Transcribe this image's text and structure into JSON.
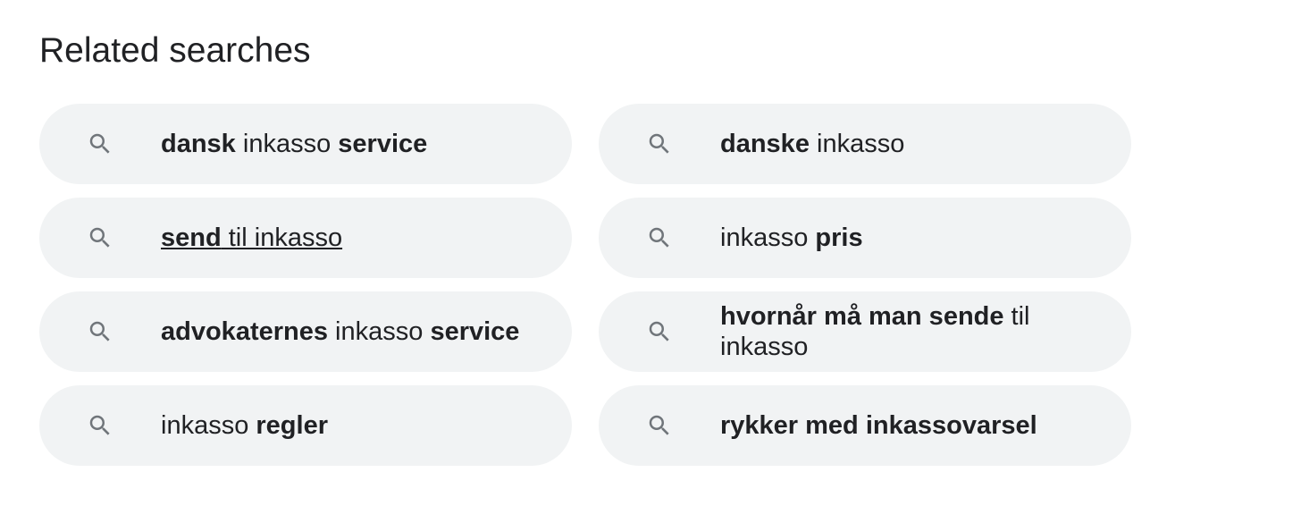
{
  "heading": "Related searches",
  "icon": "search-icon",
  "colors": {
    "chip_bg": "#f1f3f4",
    "text": "#202124",
    "icon": "#70757a"
  },
  "items": [
    {
      "segments": [
        {
          "text": "dansk",
          "bold": true
        },
        {
          "text": " inkasso ",
          "bold": false
        },
        {
          "text": "service",
          "bold": true
        }
      ]
    },
    {
      "segments": [
        {
          "text": "danske",
          "bold": true
        },
        {
          "text": " inkasso",
          "bold": false
        }
      ]
    },
    {
      "segments": [
        {
          "text": "send",
          "bold": true
        },
        {
          "text": " til inkasso",
          "bold": false
        }
      ],
      "hovered": true
    },
    {
      "segments": [
        {
          "text": "inkasso ",
          "bold": false
        },
        {
          "text": "pris",
          "bold": true
        }
      ]
    },
    {
      "segments": [
        {
          "text": "advokaternes",
          "bold": true
        },
        {
          "text": " inkasso ",
          "bold": false
        },
        {
          "text": "service",
          "bold": true
        }
      ]
    },
    {
      "segments": [
        {
          "text": "hvornår må man sende",
          "bold": true
        },
        {
          "text": " til inkasso",
          "bold": false
        }
      ]
    },
    {
      "segments": [
        {
          "text": "inkasso ",
          "bold": false
        },
        {
          "text": "regler",
          "bold": true
        }
      ]
    },
    {
      "segments": [
        {
          "text": "rykker med inkassovarsel",
          "bold": true
        }
      ]
    }
  ]
}
